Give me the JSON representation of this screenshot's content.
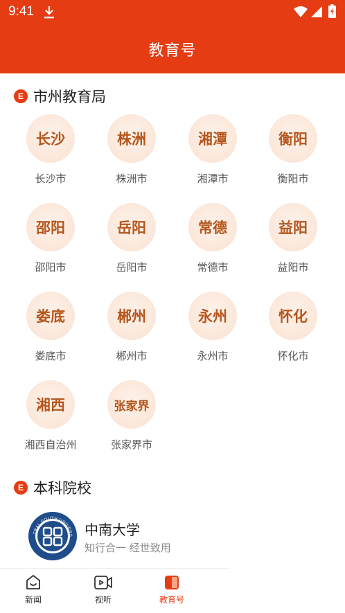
{
  "status_bar": {
    "time": "9:41"
  },
  "header": {
    "title": "教育号"
  },
  "section_bureau": {
    "badge": "E",
    "title": "市州教育局",
    "cities": [
      {
        "logo": "长沙",
        "label": "长沙市"
      },
      {
        "logo": "株洲",
        "label": "株洲市"
      },
      {
        "logo": "湘潭",
        "label": "湘潭市"
      },
      {
        "logo": "衡阳",
        "label": "衡阳市"
      },
      {
        "logo": "邵阳",
        "label": "邵阳市"
      },
      {
        "logo": "岳阳",
        "label": "岳阳市"
      },
      {
        "logo": "常德",
        "label": "常德市"
      },
      {
        "logo": "益阳",
        "label": "益阳市"
      },
      {
        "logo": "娄底",
        "label": "娄底市"
      },
      {
        "logo": "郴州",
        "label": "郴州市"
      },
      {
        "logo": "永州",
        "label": "永州市"
      },
      {
        "logo": "怀化",
        "label": "怀化市"
      },
      {
        "logo": "湘西",
        "label": "湘西自治州"
      },
      {
        "logo": "张家界",
        "label": "张家界市"
      }
    ]
  },
  "section_universities": {
    "badge": "E",
    "title": "本科院校",
    "items": [
      {
        "name": "中南大学",
        "motto": "知行合一 经世致用",
        "logo_text": "CENTRAL SOUTH UNIVERSITY"
      }
    ]
  },
  "tabbar": {
    "tabs": [
      {
        "label": "新闻",
        "icon": "news-icon",
        "active": false
      },
      {
        "label": "视听",
        "icon": "video-icon",
        "active": false
      },
      {
        "label": "教育号",
        "icon": "education-icon",
        "active": true
      }
    ]
  },
  "colors": {
    "brand": "#e63c13",
    "city_text": "#b5561d",
    "city_bg": "#fbe7d9"
  }
}
